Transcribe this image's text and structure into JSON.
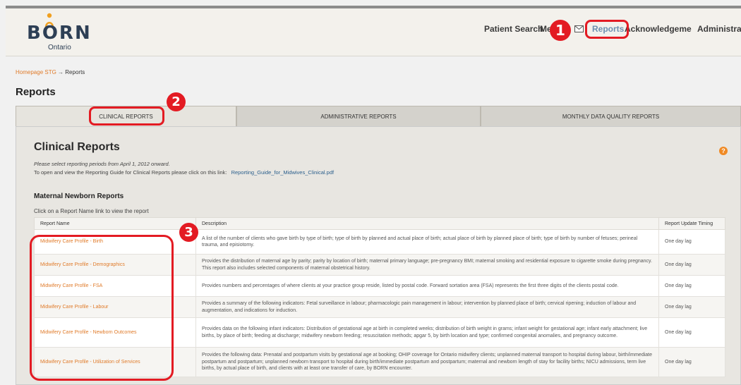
{
  "header": {
    "logo_text": "BORN",
    "logo_sub": "Ontario",
    "nav": {
      "patient_search": "Patient Search",
      "messages": "Messages",
      "reports": "Reports",
      "acknowledgement": "Acknowledgement",
      "administration": "Administration"
    }
  },
  "markers": {
    "m1": "1",
    "m2": "2",
    "m3": "3"
  },
  "breadcrumb": {
    "home": "Homepage STG",
    "separator": "→",
    "current": "Reports"
  },
  "page_title": "Reports",
  "tabs": {
    "clinical": "CLINICAL REPORTS",
    "administrative": "ADMINISTRATIVE REPORTS",
    "monthly": "MONTHLY DATA QUALITY REPORTS"
  },
  "section": {
    "title": "Clinical Reports",
    "help": "?",
    "note": "Please select reporting periods from April 1, 2012 onward.",
    "guide_text": "To open and view the Reporting Guide for Clinical Reports please click on this link:",
    "guide_link": "Reporting_Guide_for_Midwives_Clinical.pdf",
    "subtitle": "Maternal Newborn Reports",
    "instruction": "Click on a Report Name link to view the report"
  },
  "table": {
    "headers": {
      "name": "Report Name",
      "description": "Description",
      "timing": "Report Update Timing"
    },
    "rows": [
      {
        "name": "Midwifery Care Profile - Birth",
        "description": "A list of the number of clients who gave birth by type of birth; type of birth by planned and actual place of birth; actual place of birth by planned place of birth; type of birth by number of fetuses; perineal trauma, and episiotomy.",
        "timing": "One day lag"
      },
      {
        "name": "Midwifery Care Profile - Demographics",
        "description": "Provides the distribution of maternal age by parity; parity by location of birth; maternal primary language; pre-pregnancy BMI; maternal smoking and residential exposure to cigarette smoke during pregnancy. This report also includes selected components of maternal obstetrical history.",
        "timing": "One day lag"
      },
      {
        "name": "Midwifery Care Profile - FSA",
        "description": "Provides numbers and percentages of where clients at your practice group reside, listed by postal code. Forward sortation area (FSA) represents the first three digits of the clients postal code.",
        "timing": "One day lag"
      },
      {
        "name": "Midwifery Care Profile - Labour",
        "description": "Provides a summary of the following indicators: Fetal surveillance in labour; pharmacologic pain management in labour; intervention by planned place of birth; cervical ripening; induction of labour and augmentation, and indications for induction.",
        "timing": "One day lag"
      },
      {
        "name": "Midwifery Care Profile - Newborn Outcomes",
        "description": "Provides data on the following infant indicators: Distribution of gestational age at birth in completed weeks; distribution of birth weight in grams; infant weight for gestational age; infant early attachment; live births, by place of birth; feeding at discharge; midwifery newborn feeding; resuscitation methods; apgar 5, by birth location and type; confirmed congenital anomalies, and pregnancy outcome.",
        "timing": "One day lag"
      },
      {
        "name": "Midwifery Care Profile - Utilization of Services",
        "description": "Provides the following data: Prenatal and postpartum visits by gestational age at booking; OHIP coverage for Ontario midwifery clients; unplanned maternal transport to hospital during labour, birth/immediate postpartum and postpartum; unplanned newborn transport to hospital during birth/immediate postpartum and postpartum; maternal and newborn length of stay for facility births; NICU admissions, term live births, by actual place of birth, and clients with at least one transfer of care, by BORN encounter.",
        "timing": "One day lag"
      }
    ]
  },
  "colors": {
    "accent": "#e07b2a",
    "annotation": "#e31b23",
    "link": "#2b5f8c",
    "brand": "#2d3f55"
  }
}
